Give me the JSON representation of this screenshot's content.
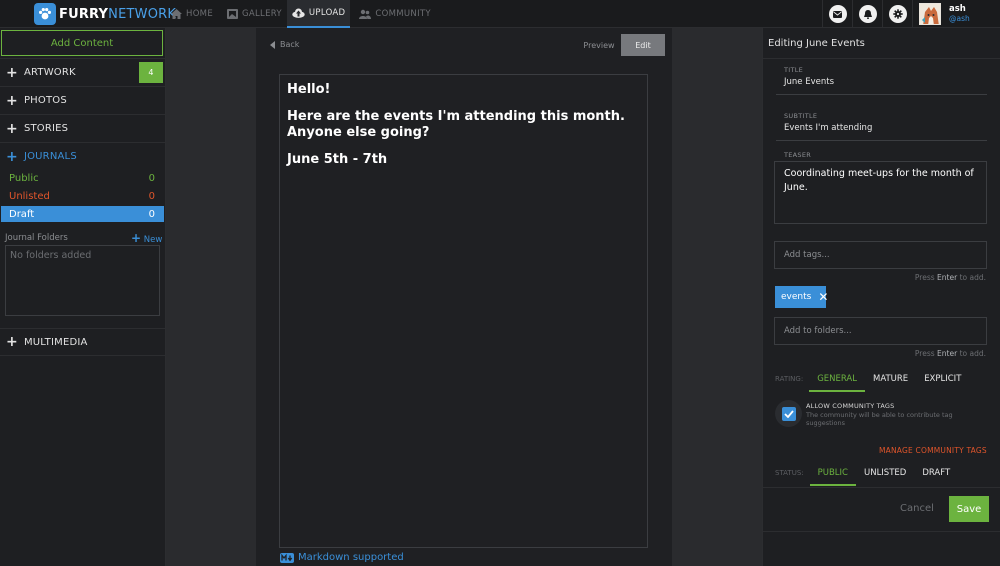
{
  "brand": {
    "furry": "FURRY",
    "network": "NETWORK"
  },
  "nav": [
    {
      "label": "HOME",
      "icon": "home-icon"
    },
    {
      "label": "GALLERY",
      "icon": "gallery-icon"
    },
    {
      "label": "UPLOAD",
      "icon": "upload-icon",
      "active": true
    },
    {
      "label": "COMMUNITY",
      "icon": "community-icon"
    }
  ],
  "user": {
    "name": "ash",
    "handle": "@ash"
  },
  "sidebar": {
    "add_content": "Add Content",
    "sections": {
      "artwork": {
        "label": "ARTWORK",
        "badge": "4"
      },
      "photos": {
        "label": "PHOTOS"
      },
      "stories": {
        "label": "STORIES"
      },
      "journals": {
        "label": "JOURNALS"
      },
      "multimedia": {
        "label": "MULTIMEDIA"
      }
    },
    "journal_status": {
      "public": {
        "label": "Public",
        "count": "0"
      },
      "unlisted": {
        "label": "Unlisted",
        "count": "0"
      },
      "draft": {
        "label": "Draft",
        "count": "0"
      }
    },
    "folders_label": "Journal Folders",
    "folders_new": "New",
    "folders_empty": "No folders added"
  },
  "editor": {
    "back": "Back",
    "preview": "Preview",
    "edit": "Edit",
    "paragraphs": [
      "Hello!",
      "Here are the events I'm attending this month. Anyone else going?",
      "June 5th - 7th"
    ],
    "markdown": "Markdown supported"
  },
  "panel": {
    "heading": "Editing June Events",
    "title_label": "TITLE",
    "title_value": "June Events",
    "subtitle_label": "SUBTITLE",
    "subtitle_value": "Events I'm attending",
    "teaser_label": "TEASER",
    "teaser_value": "Coordinating meet-ups for the month of June.",
    "tags_placeholder": "Add tags...",
    "hint_prefix": "Press",
    "hint_key": "Enter",
    "hint_suffix": "to add.",
    "tag": "events",
    "folders_placeholder": "Add to folders...",
    "rating_label": "RATING:",
    "rating_options": [
      "GENERAL",
      "MATURE",
      "EXPLICIT"
    ],
    "allow_title": "ALLOW COMMUNITY TAGS",
    "allow_desc": "The community will be able to contribute tag suggestions",
    "manage_link": "MANAGE COMMUNITY TAGS",
    "status_label": "STATUS:",
    "status_options": [
      "PUBLIC",
      "UNLISTED",
      "DRAFT"
    ],
    "cancel": "Cancel",
    "save": "Save"
  },
  "colors": {
    "accent_blue": "#3a8fd8",
    "accent_green": "#6cb33f",
    "accent_orange": "#e0552b"
  }
}
